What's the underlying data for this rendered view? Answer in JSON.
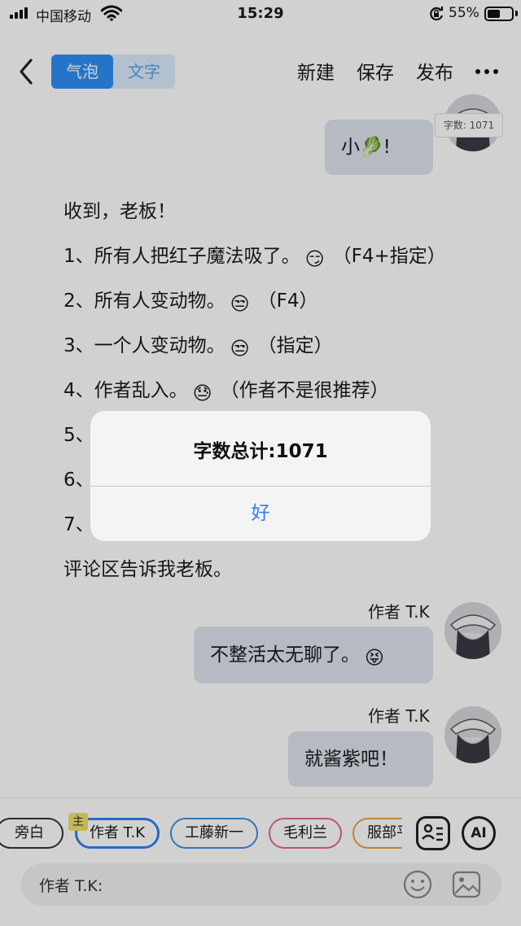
{
  "status_bar": {
    "carrier": "中国移动",
    "time": "15:29",
    "battery_percent": "55%",
    "battery_level": 0.55
  },
  "header": {
    "segment": [
      "气泡",
      "文字"
    ],
    "actions": {
      "new": "新建",
      "save": "保存",
      "publish": "发布"
    }
  },
  "count_tag": "字数: 1071",
  "messages": {
    "top_bubble": "小🥬!",
    "narration": [
      "收到，老板！",
      {
        "prefix": "1、所有人把红子魔法吸了。",
        "emoji": "😏",
        "suffix": "（F4+指定）"
      },
      {
        "prefix": "2、所有人变动物。",
        "emoji": "😒",
        "suffix": "（F4）"
      },
      {
        "prefix": "3、一个人变动物。",
        "emoji": "😒",
        "suffix": "（指定）"
      },
      {
        "prefix": "4、作者乱入。",
        "emoji": "😓",
        "suffix": "（作者不是很推荐）"
      },
      "5、",
      "6、",
      "7、",
      "评论区告诉我老板。"
    ],
    "msg1": {
      "speaker": "作者 T.K",
      "text": "不整活太无聊了。",
      "emoji": "😝"
    },
    "msg2": {
      "speaker": "作者 T.K",
      "text": "就酱紫吧！"
    }
  },
  "alert": {
    "title": "字数总计:1071",
    "ok": "好"
  },
  "bottom": {
    "roles": [
      "旁白",
      "作者 T.K",
      "工藤新一",
      "毛利兰",
      "服部平"
    ],
    "host_badge": "主",
    "role_colors": [
      "#333333",
      "#2f7ff0",
      "#3d8fe0",
      "#e06a86",
      "#e9a23b"
    ],
    "input_prefix": "作者 T.K:"
  }
}
